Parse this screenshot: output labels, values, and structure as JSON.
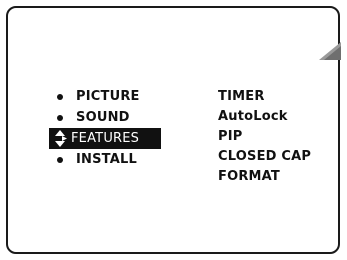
{
  "menu": {
    "items": [
      {
        "label": "PICTURE"
      },
      {
        "label": "SOUND"
      },
      {
        "label": "FEATURES",
        "selected": true
      },
      {
        "label": "INSTALL"
      }
    ]
  },
  "submenu": {
    "items": [
      {
        "label": "TIMER"
      },
      {
        "label": "AutoLock"
      },
      {
        "label": "PIP"
      },
      {
        "label": "CLOSED CAP"
      },
      {
        "label": "FORMAT"
      }
    ]
  },
  "icons": {
    "corner": "corner-wedge-icon",
    "bullet": "bullet-icon",
    "selector": "up-down-arrow-icon"
  },
  "colors": {
    "foreground": "#111111",
    "background": "#ffffff",
    "highlight": "#111111",
    "highlight_text": "#ffffff"
  }
}
